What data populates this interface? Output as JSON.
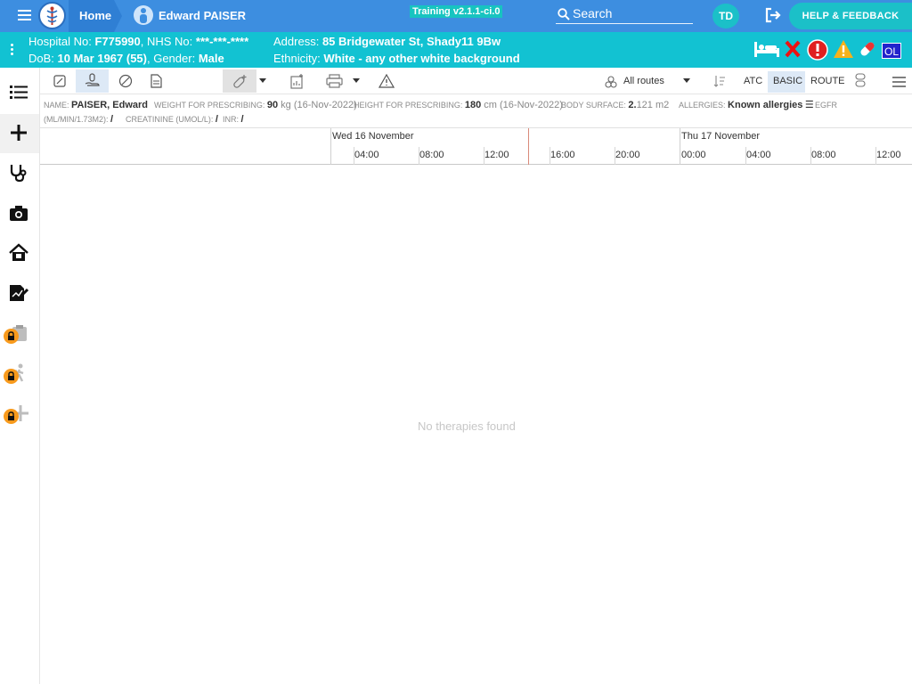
{
  "header": {
    "home_label": "Home",
    "patient_name": "Edward PAISER",
    "training_badge": "Training v2.1.1-ci.0",
    "search_label": "Search",
    "user_initials": "TD",
    "help_label": "HELP & FEEDBACK"
  },
  "banner": {
    "hospital_label": "Hospital No:",
    "hospital_no": "F775990",
    "nhs_label": ", NHS No:",
    "nhs_no": "***-***-****",
    "dob_label": "DoB:",
    "dob": "10 Mar 1967 (55)",
    "gender_label": ", Gender:",
    "gender": "Male",
    "address_label": "Address:",
    "address": "85 Bridgewater St, Shady11 9Bw",
    "ethnicity_label": "Ethnicity:",
    "ethnicity": "White - any other white background",
    "ol_badge": "OL"
  },
  "toolbar": {
    "routes_label": "All routes",
    "atc_label": "ATC",
    "basic_label": "BASIC",
    "route_label": "ROUTE"
  },
  "info": {
    "name_label": "NAME:",
    "name": "PAISER, Edward",
    "weight_label": "WEIGHT FOR PRESCRIBING:",
    "weight": "90",
    "weight_unit": " kg (16-Nov-2022)",
    "height_label": "HEIGHT FOR PRESCRIBING:",
    "height": "180",
    "height_unit": " cm (16-Nov-2022)",
    "bsa_label": "BODY SURFACE:",
    "bsa_int": "2.",
    "bsa_dec": "121 m2",
    "allergies_label": "ALLERGIES:",
    "allergies": "Known allergies",
    "egfr_label": "EGFR",
    "egfr_unit": "(ML/MIN/1.73M2):",
    "egfr_value": "/",
    "creatinine_label": "CREATININE (UMOL/L):",
    "creatinine_value": "/",
    "inr_label": "INR:",
    "inr_value": "/"
  },
  "timeline": {
    "day1": "Wed 16 November",
    "day2": "Thu 17 November",
    "hours": [
      "04:00",
      "08:00",
      "12:00",
      "16:00",
      "20:00",
      "00:00",
      "04:00",
      "08:00",
      "12:00"
    ]
  },
  "empty_message": "No therapies found",
  "colors": {
    "topbar": "#3d8ee0",
    "banner": "#12c2d2",
    "accent": "#1bc0c8",
    "lock": "#f89a1c"
  }
}
